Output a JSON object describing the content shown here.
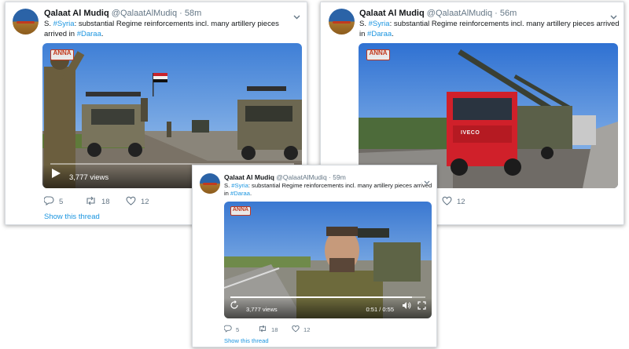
{
  "tweets": [
    {
      "name": "Qalaat Al Mudiq",
      "handle": "@QalaatAlMudiq",
      "time": "· 58m",
      "text_prefix": "S. ",
      "hashtag1": "#Syria",
      "text_middle": ": substantial Regime reinforcements incl. many artillery pieces arrived in",
      "hashtag2": "#Daraa",
      "text_suffix": ".",
      "views": "3,777 views",
      "replies": "5",
      "retweets": "18",
      "likes": "12",
      "show_thread": "Show this thread",
      "logo_text": "ANNA"
    },
    {
      "name": "Qalaat Al Mudiq",
      "handle": "@QalaatAlMudiq",
      "time": "· 56m",
      "text_prefix": "S. ",
      "hashtag1": "#Syria",
      "text_middle": ": substantial Regime reinforcements incl. many artillery pieces arrived in",
      "hashtag2": "#Daraa",
      "text_suffix": ".",
      "likes": "12",
      "truck_brand": "IVECO",
      "logo_text": "ANNA"
    },
    {
      "name": "Qalaat Al Mudiq",
      "handle": "@QalaatAlMudiq",
      "time": "· 59m",
      "text_prefix": "S. ",
      "hashtag1": "#Syria",
      "text_middle": ": substantial Regime reinforcements incl. many artillery pieces arrived in",
      "hashtag2": "#Daraa",
      "text_suffix": ".",
      "views": "3,777 views",
      "elapsed": "0:51 / 0:55",
      "replies": "5",
      "retweets": "18",
      "likes": "12",
      "show_thread": "Show this thread",
      "logo_text": "ANNA"
    }
  ],
  "colors": {
    "link": "#1b95e0",
    "muted": "#657786",
    "truck_red": "#d0202a"
  },
  "icons": [
    "chevron-down-icon",
    "reply-icon",
    "retweet-icon",
    "like-icon",
    "play-icon",
    "replay-icon",
    "volume-icon",
    "fullscreen-icon"
  ]
}
